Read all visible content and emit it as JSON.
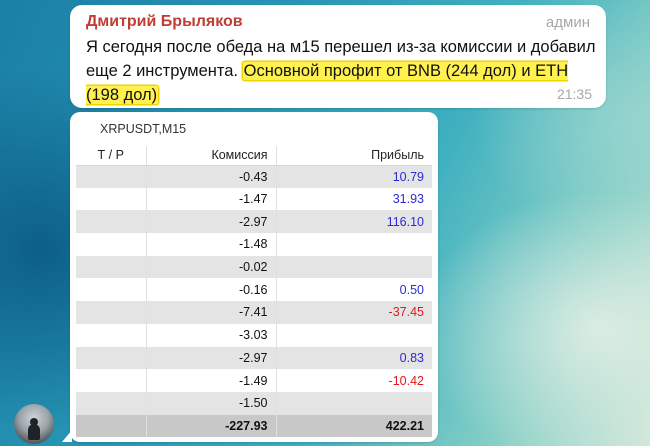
{
  "message": {
    "sender": "Дмитрий Брыляков",
    "role": "админ",
    "text_plain": "Я сегодня после обеда на м15 перешел из-за комиссии и добавил еще 2 инструмента. ",
    "text_highlighted": "Основной профит от BNB (244 дол) и ETH (198 дол)",
    "time": "21:35"
  },
  "table": {
    "title": "XRPUSDT,M15",
    "headers": {
      "tp": "Т / Р",
      "commission": "Комиссия",
      "profit": "Прибыль"
    },
    "rows": [
      {
        "tp": "",
        "commission": "-0.43",
        "profit": "10.79"
      },
      {
        "tp": "",
        "commission": "-1.47",
        "profit": "31.93"
      },
      {
        "tp": "",
        "commission": "-2.97",
        "profit": "116.10"
      },
      {
        "tp": "",
        "commission": "-1.48",
        "profit": ""
      },
      {
        "tp": "",
        "commission": "-0.02",
        "profit": ""
      },
      {
        "tp": "",
        "commission": "-0.16",
        "profit": "0.50"
      },
      {
        "tp": "",
        "commission": "-7.41",
        "profit": "-37.45"
      },
      {
        "tp": "",
        "commission": "-3.03",
        "profit": ""
      },
      {
        "tp": "",
        "commission": "-2.97",
        "profit": "0.83"
      },
      {
        "tp": "",
        "commission": "-1.49",
        "profit": "-10.42"
      },
      {
        "tp": "",
        "commission": "-1.50",
        "profit": ""
      }
    ],
    "totals": {
      "commission": "-227.93",
      "profit": "422.21"
    }
  },
  "colors": {
    "sender": "#c03d33",
    "highlight": "#fff14f",
    "positive": "#2a2ad6",
    "negative": "#e01b1b"
  },
  "avatar": {
    "icon": "user-avatar-icon"
  }
}
